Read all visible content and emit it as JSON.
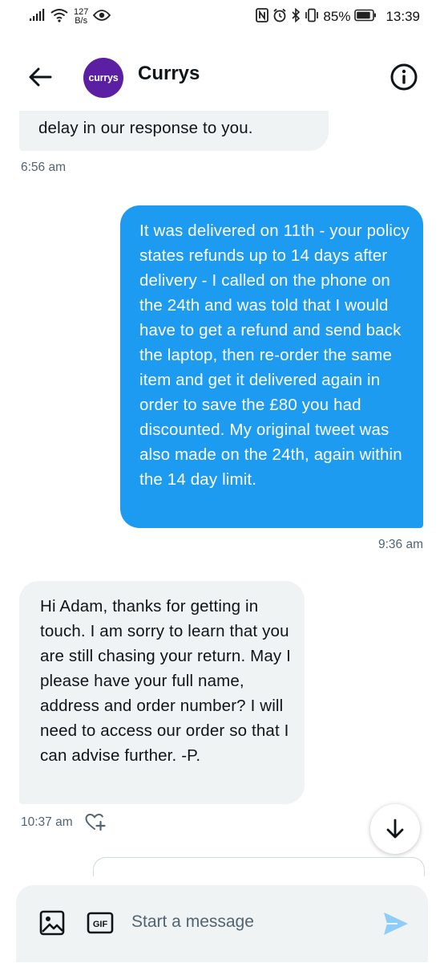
{
  "status_bar": {
    "network_speed_value": "127",
    "network_speed_unit": "B/s",
    "battery": "85%",
    "time": "13:39"
  },
  "header": {
    "avatar_text": "currys",
    "title": "Currys",
    "brand_color": "#5a1fa3"
  },
  "messages": [
    {
      "side": "received",
      "text": "delay in our response to you.",
      "time": "6:56 am"
    },
    {
      "side": "sent",
      "text": "It was delivered on 11th - your policy states refunds up to 14 days after delivery - I called on the phone on the 24th and was told that I would have to get a refund and send back the laptop, then  re-order the same item and get it delivered again in order to save the £80 you had discounted. My original tweet was also made on the 24th, again within the 14 day limit.",
      "time": "9:36 am"
    },
    {
      "side": "received",
      "text": "Hi Adam, thanks for getting in touch. I am sorry to learn that you are still chasing your return. May I please have your full name, address and order number? I will need to access our order so that I can advise further. -P.",
      "time": "10:37 am"
    }
  ],
  "composer": {
    "placeholder": "Start a message",
    "gif_label": "GIF"
  },
  "colors": {
    "sent_bubble": "#1d9bf0",
    "received_bubble": "#eff3f4",
    "secondary_text": "#536471",
    "send_icon": "#8ecdf7"
  },
  "icons": [
    "back-arrow-icon",
    "info-icon",
    "react-heart-plus-icon",
    "scroll-down-arrow-icon",
    "photo-icon",
    "gif-icon",
    "send-icon",
    "signal-icon",
    "wifi-icon",
    "eye-icon",
    "nfc-icon",
    "alarm-icon",
    "bluetooth-icon",
    "vibrate-icon",
    "battery-icon"
  ]
}
